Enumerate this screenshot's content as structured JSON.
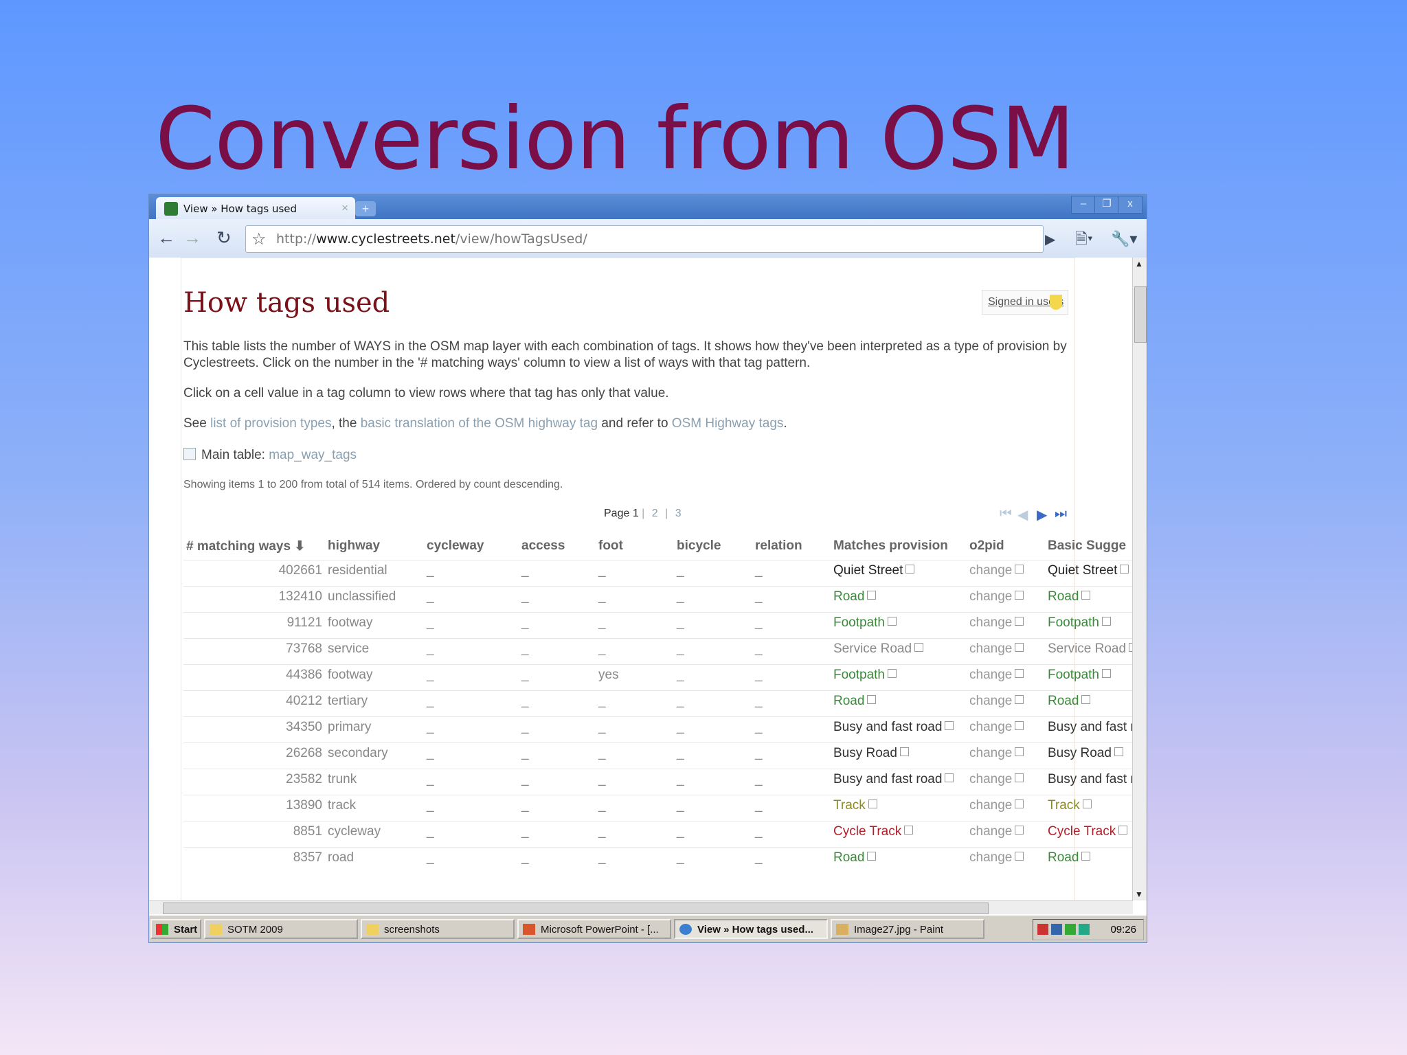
{
  "slide": {
    "title": "Conversion from OSM"
  },
  "browser": {
    "tab_title": "View » How tags used",
    "tab_close": "×",
    "new_tab": "+",
    "win_min": "–",
    "win_max": "❐",
    "win_close": "x",
    "url_prefix": "http://",
    "url_domain": "www.cyclestreets.net",
    "url_path": "/view/howTagsUsed/"
  },
  "page": {
    "heading": "How tags used",
    "signed_in": "Signed in users",
    "para1": "This table lists the number of WAYS in the OSM map layer with each combination of tags. It shows how they've been interpreted as a type of provision by Cyclestreets. Click on the number in the '# matching ways' column to view a list of ways with that tag pattern.",
    "para2": "Click on a cell value in a tag column to view rows where that tag has only that value.",
    "para3_see": "See ",
    "para3_link1": "list of provision types",
    "para3_mid": ", the ",
    "para3_link2": "basic translation of the OSM highway tag",
    "para3_mid2": " and refer to ",
    "para3_link3": "OSM Highway tags",
    "para3_end": ".",
    "main_table_label": "Main table:",
    "main_table_link": "map_way_tags",
    "showing": "Showing items 1 to 200 from total of 514 items. Ordered by count descending.",
    "pager": {
      "label": "Page 1",
      "p2": "2",
      "p3": "3",
      "sep": "|"
    }
  },
  "table": {
    "headers": [
      "# matching ways",
      "highway",
      "cycleway",
      "access",
      "foot",
      "bicycle",
      "relation",
      "Matches provision",
      "o2pid",
      "Basic Sugge"
    ],
    "sort_arrow": "⬇",
    "dash": "_",
    "change": "change",
    "rows": [
      {
        "count": "402661",
        "highway": "residential",
        "foot": "",
        "provision": "Quiet Street",
        "provision_color": "black",
        "basic": "Quiet Street",
        "basic_color": "black"
      },
      {
        "count": "132410",
        "highway": "unclassified",
        "foot": "",
        "provision": "Road",
        "provision_color": "green",
        "basic": "Road",
        "basic_color": "green"
      },
      {
        "count": "91121",
        "highway": "footway",
        "foot": "",
        "provision": "Footpath",
        "provision_color": "green",
        "basic": "Footpath",
        "basic_color": "green"
      },
      {
        "count": "73768",
        "highway": "service",
        "foot": "",
        "provision": "Service Road",
        "provision_color": "gray",
        "basic": "Service Road",
        "basic_color": "gray"
      },
      {
        "count": "44386",
        "highway": "footway",
        "foot": "yes",
        "provision": "Footpath",
        "provision_color": "green",
        "basic": "Footpath",
        "basic_color": "green"
      },
      {
        "count": "40212",
        "highway": "tertiary",
        "foot": "",
        "provision": "Road",
        "provision_color": "green",
        "basic": "Road",
        "basic_color": "green"
      },
      {
        "count": "34350",
        "highway": "primary",
        "foot": "",
        "provision": "Busy and fast road",
        "provision_color": "dark",
        "basic": "Busy and fast road",
        "basic_color": "dark"
      },
      {
        "count": "26268",
        "highway": "secondary",
        "foot": "",
        "provision": "Busy Road",
        "provision_color": "dark",
        "basic": "Busy Road",
        "basic_color": "dark"
      },
      {
        "count": "23582",
        "highway": "trunk",
        "foot": "",
        "provision": "Busy and fast road",
        "provision_color": "dark",
        "basic": "Busy and fast road",
        "basic_color": "dark"
      },
      {
        "count": "13890",
        "highway": "track",
        "foot": "",
        "provision": "Track",
        "provision_color": "olive",
        "basic": "Track",
        "basic_color": "olive"
      },
      {
        "count": "8851",
        "highway": "cycleway",
        "foot": "",
        "provision": "Cycle Track",
        "provision_color": "red",
        "basic": "Cycle Track",
        "basic_color": "red"
      },
      {
        "count": "8357",
        "highway": "road",
        "foot": "",
        "provision": "Road",
        "provision_color": "green",
        "basic": "Road",
        "basic_color": "green"
      }
    ]
  },
  "taskbar": {
    "start": "Start",
    "items": [
      "SOTM 2009",
      "screenshots",
      "Microsoft PowerPoint - [...",
      "View » How tags used...",
      "Image27.jpg - Paint"
    ],
    "clock": "09:26"
  },
  "colors": {
    "title": "#7a0f47",
    "heading": "#7b1118",
    "green": "#3a8a3a",
    "red": "#b0202a"
  }
}
